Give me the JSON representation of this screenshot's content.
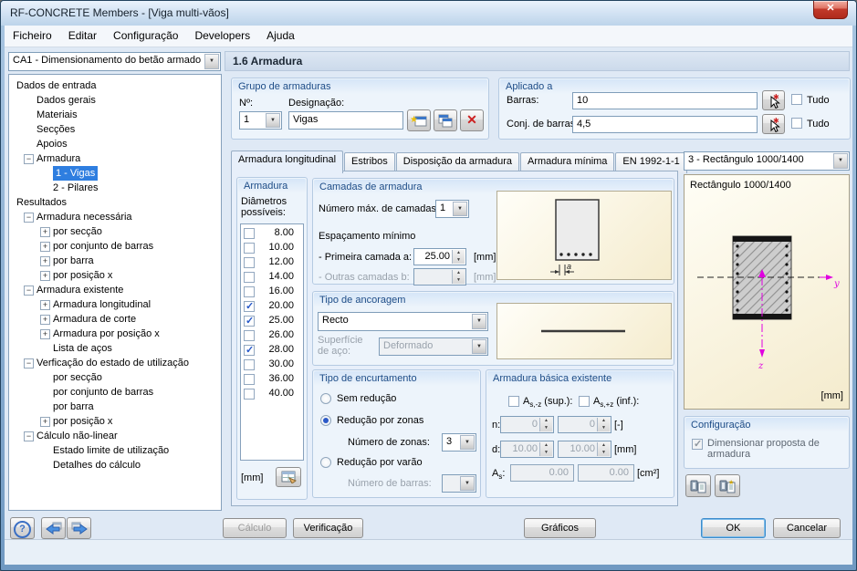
{
  "window": {
    "title": "RF-CONCRETE Members - [Viga multi-vãos]",
    "close_glyph": "✕"
  },
  "menu": {
    "items": [
      "Ficheiro",
      "Editar",
      "Configuração",
      "Developers",
      "Ajuda"
    ]
  },
  "toolbar": {
    "case": "CA1 - Dimensionamento do betão armado",
    "panel_title": "1.6 Armadura"
  },
  "tree": {
    "items": [
      {
        "label": "Dados de entrada",
        "indent": 0,
        "glyph": "none",
        "selected": false
      },
      {
        "label": "Dados gerais",
        "indent": 1,
        "glyph": "none",
        "selected": false
      },
      {
        "label": "Materiais",
        "indent": 1,
        "glyph": "none",
        "selected": false
      },
      {
        "label": "Secções",
        "indent": 1,
        "glyph": "none",
        "selected": false
      },
      {
        "label": "Apoios",
        "indent": 1,
        "glyph": "none",
        "selected": false
      },
      {
        "label": "Armadura",
        "indent": 1,
        "glyph": "minus",
        "selected": false
      },
      {
        "label": "1 - Vigas",
        "indent": 2,
        "glyph": "none",
        "selected": true
      },
      {
        "label": "2 - Pilares",
        "indent": 2,
        "glyph": "none",
        "selected": false
      },
      {
        "label": "Resultados",
        "indent": 0,
        "glyph": "none",
        "selected": false
      },
      {
        "label": "Armadura necessária",
        "indent": 1,
        "glyph": "minus",
        "selected": false
      },
      {
        "label": "por secção",
        "indent": 2,
        "glyph": "plus",
        "selected": false
      },
      {
        "label": "por conjunto de barras",
        "indent": 2,
        "glyph": "plus",
        "selected": false
      },
      {
        "label": "por barra",
        "indent": 2,
        "glyph": "plus",
        "selected": false
      },
      {
        "label": "por posição x",
        "indent": 2,
        "glyph": "plus",
        "selected": false
      },
      {
        "label": "Armadura existente",
        "indent": 1,
        "glyph": "minus",
        "selected": false
      },
      {
        "label": "Armadura longitudinal",
        "indent": 2,
        "glyph": "plus",
        "selected": false
      },
      {
        "label": "Armadura de corte",
        "indent": 2,
        "glyph": "plus",
        "selected": false
      },
      {
        "label": "Armadura por posição x",
        "indent": 2,
        "glyph": "plus",
        "selected": false
      },
      {
        "label": "Lista de aços",
        "indent": 2,
        "glyph": "none",
        "selected": false
      },
      {
        "label": "Verficação do estado de utilização",
        "indent": 1,
        "glyph": "minus",
        "selected": false
      },
      {
        "label": "por secção",
        "indent": 2,
        "glyph": "none",
        "selected": false
      },
      {
        "label": "por conjunto de barras",
        "indent": 2,
        "glyph": "none",
        "selected": false
      },
      {
        "label": "por barra",
        "indent": 2,
        "glyph": "none",
        "selected": false
      },
      {
        "label": "por posição x",
        "indent": 2,
        "glyph": "plus",
        "selected": false
      },
      {
        "label": "Cálculo não-linear",
        "indent": 1,
        "glyph": "minus",
        "selected": false
      },
      {
        "label": "Estado limite de utilização",
        "indent": 2,
        "glyph": "none",
        "selected": false
      },
      {
        "label": "Detalhes do cálculo",
        "indent": 2,
        "glyph": "none",
        "selected": false
      }
    ]
  },
  "grupo": {
    "title": "Grupo de armaduras",
    "no_label": "Nº:",
    "no_value": "1",
    "des_label": "Designação:",
    "des_value": "Vigas"
  },
  "aplicado": {
    "title": "Aplicado a",
    "bars_label": "Barras:",
    "bars_value": "10",
    "sets_label": "Conj. de barras:",
    "sets_value": "4,5",
    "all_label": "Tudo",
    "bars_all_checked": false,
    "sets_all_checked": false
  },
  "tabs": {
    "labels": [
      "Armadura longitudinal",
      "Estribos",
      "Disposição da armadura",
      "Armadura mínima",
      "EN 1992-1-1"
    ],
    "active": 0
  },
  "rebar": {
    "title": "Armadura",
    "possible_label": "Diâmetros possíveis:",
    "unit": "[mm]",
    "diameters": [
      {
        "value": "8.00",
        "checked": false
      },
      {
        "value": "10.00",
        "checked": false
      },
      {
        "value": "12.00",
        "checked": false
      },
      {
        "value": "14.00",
        "checked": false
      },
      {
        "value": "16.00",
        "checked": false
      },
      {
        "value": "20.00",
        "checked": true
      },
      {
        "value": "25.00",
        "checked": true
      },
      {
        "value": "26.00",
        "checked": false
      },
      {
        "value": "28.00",
        "checked": true
      },
      {
        "value": "30.00",
        "checked": false
      },
      {
        "value": "36.00",
        "checked": false
      },
      {
        "value": "40.00",
        "checked": false
      }
    ]
  },
  "layers": {
    "title": "Camadas de armadura",
    "max_label": "Número máx. de camadas:",
    "max_value": "1",
    "spacing_label": "Espaçamento mínimo",
    "first_label": "- Primeira camada   a:",
    "first_value": "25.00",
    "unit_mm": "[mm]",
    "others_label": "- Outras camadas   b:",
    "others_value": "",
    "diagram_dim": "a"
  },
  "anchorage": {
    "title": "Tipo de ancoragem",
    "type_value": "Recto",
    "surface_label": "Superfície de aço:",
    "surface_value": "Deformado"
  },
  "curtail": {
    "title": "Tipo de encurtamento",
    "options": [
      {
        "label": "Sem redução",
        "selected": false
      },
      {
        "label": "Redução por zonas",
        "selected": true
      },
      {
        "label": "Redução por varão",
        "selected": false
      }
    ],
    "zones_label": "Número de zonas:",
    "zones_value": "3",
    "bars_label": "Número de barras:",
    "bars_value": ""
  },
  "basic": {
    "title": "Armadura básica existente",
    "top_main": "A",
    "top_sub": "s,-z",
    "top_rest": " (sup.):",
    "top_checked": false,
    "bot_main": "A",
    "bot_sub": "s,+z",
    "bot_rest": " (inf.):",
    "bot_checked": false,
    "n_label": "n:",
    "n1": "0",
    "n2": "0",
    "n_unit": "[-]",
    "d_label": "d:",
    "d1": "10.00",
    "d2": "10.00",
    "d_unit": "[mm]",
    "as_main": "A",
    "as_sub": "s",
    "as_rest": ":",
    "as1": "0.00",
    "as2": "0.00",
    "as_unit": "[cm²]"
  },
  "section": {
    "selector": "3 - Rectângulo 1000/1400",
    "title": "Rectângulo 1000/1400",
    "unit": "[mm]",
    "axis_y": "y",
    "axis_z": "z"
  },
  "config": {
    "title": "Configuração",
    "design_label": "Dimensionar proposta de armadura",
    "design_checked": true
  },
  "footer": {
    "calc": "Cálculo",
    "check": "Verificação",
    "graphics": "Gráficos",
    "ok": "OK",
    "cancel": "Cancelar"
  }
}
